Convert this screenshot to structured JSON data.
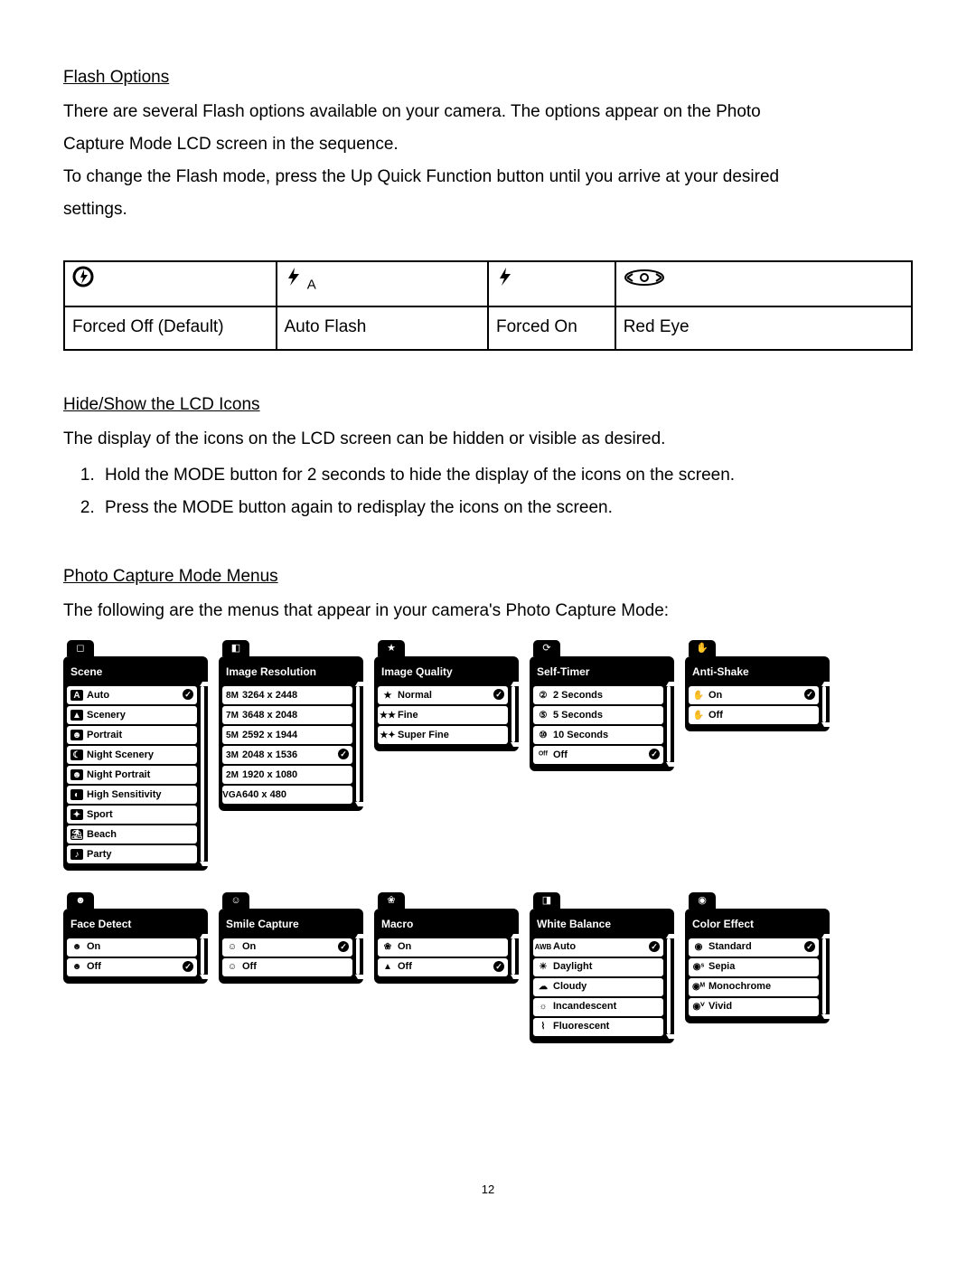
{
  "page_number": "12",
  "flash_section": {
    "heading": "Flash Options",
    "p1": "There are several Flash options available on your camera. The options appear on the Photo",
    "p2": "Capture Mode LCD screen in the sequence.",
    "p3": "To change the Flash mode, press the Up Quick Function button until you arrive at your desired",
    "p4": "settings.",
    "cells": [
      "Forced Off (Default)",
      "Auto Flash",
      "Forced On",
      "Red Eye"
    ]
  },
  "lcd_section": {
    "heading": "Hide/Show the LCD Icons",
    "p1": "The display of the icons on the LCD screen can be hidden or visible as desired.",
    "step1": "Hold the MODE button for 2 seconds to hide the display of the icons on the screen.",
    "step2": "Press the MODE button again to redisplay the icons on the screen."
  },
  "menus_section": {
    "heading": "Photo Capture Mode Menus",
    "p1": "The following are the menus that appear in your camera's Photo Capture Mode:"
  },
  "menus": {
    "scene": {
      "title": "Scene",
      "items": [
        "Auto",
        "Scenery",
        "Portrait",
        "Night Scenery",
        "Night Portrait",
        "High Sensitivity",
        "Sport",
        "Beach",
        "Party"
      ],
      "selected": 0
    },
    "resolution": {
      "title": "Image Resolution",
      "items": [
        "3264 x 2448",
        "3648 x 2048",
        "2592 x 1944",
        "2048 x 1536",
        "1920 x 1080",
        "640 x 480"
      ],
      "prefixes": [
        "8M",
        "7M",
        "5M",
        "3M",
        "2M",
        "VGA"
      ],
      "selected": 3
    },
    "quality": {
      "title": "Image Quality",
      "items": [
        "Normal",
        "Fine",
        "Super Fine"
      ],
      "selected": 0
    },
    "selftimer": {
      "title": "Self-Timer",
      "items": [
        "2 Seconds",
        "5 Seconds",
        "10 Seconds",
        "Off"
      ],
      "selected": 3
    },
    "antishake": {
      "title": "Anti-Shake",
      "items": [
        "On",
        "Off"
      ],
      "selected": 0
    },
    "facedetect": {
      "title": "Face Detect",
      "items": [
        "On",
        "Off"
      ],
      "selected": 1
    },
    "smile": {
      "title": "Smile Capture",
      "items": [
        "On",
        "Off"
      ],
      "selected": 0
    },
    "macro": {
      "title": "Macro",
      "items": [
        "On",
        "Off"
      ],
      "selected": 1
    },
    "wb": {
      "title": "White Balance",
      "items": [
        "Auto",
        "Daylight",
        "Cloudy",
        "Incandescent",
        "Fluorescent"
      ],
      "selected": 0
    },
    "color": {
      "title": "Color Effect",
      "items": [
        "Standard",
        "Sepia",
        "Monochrome",
        "Vivid"
      ],
      "selected": 0
    }
  }
}
